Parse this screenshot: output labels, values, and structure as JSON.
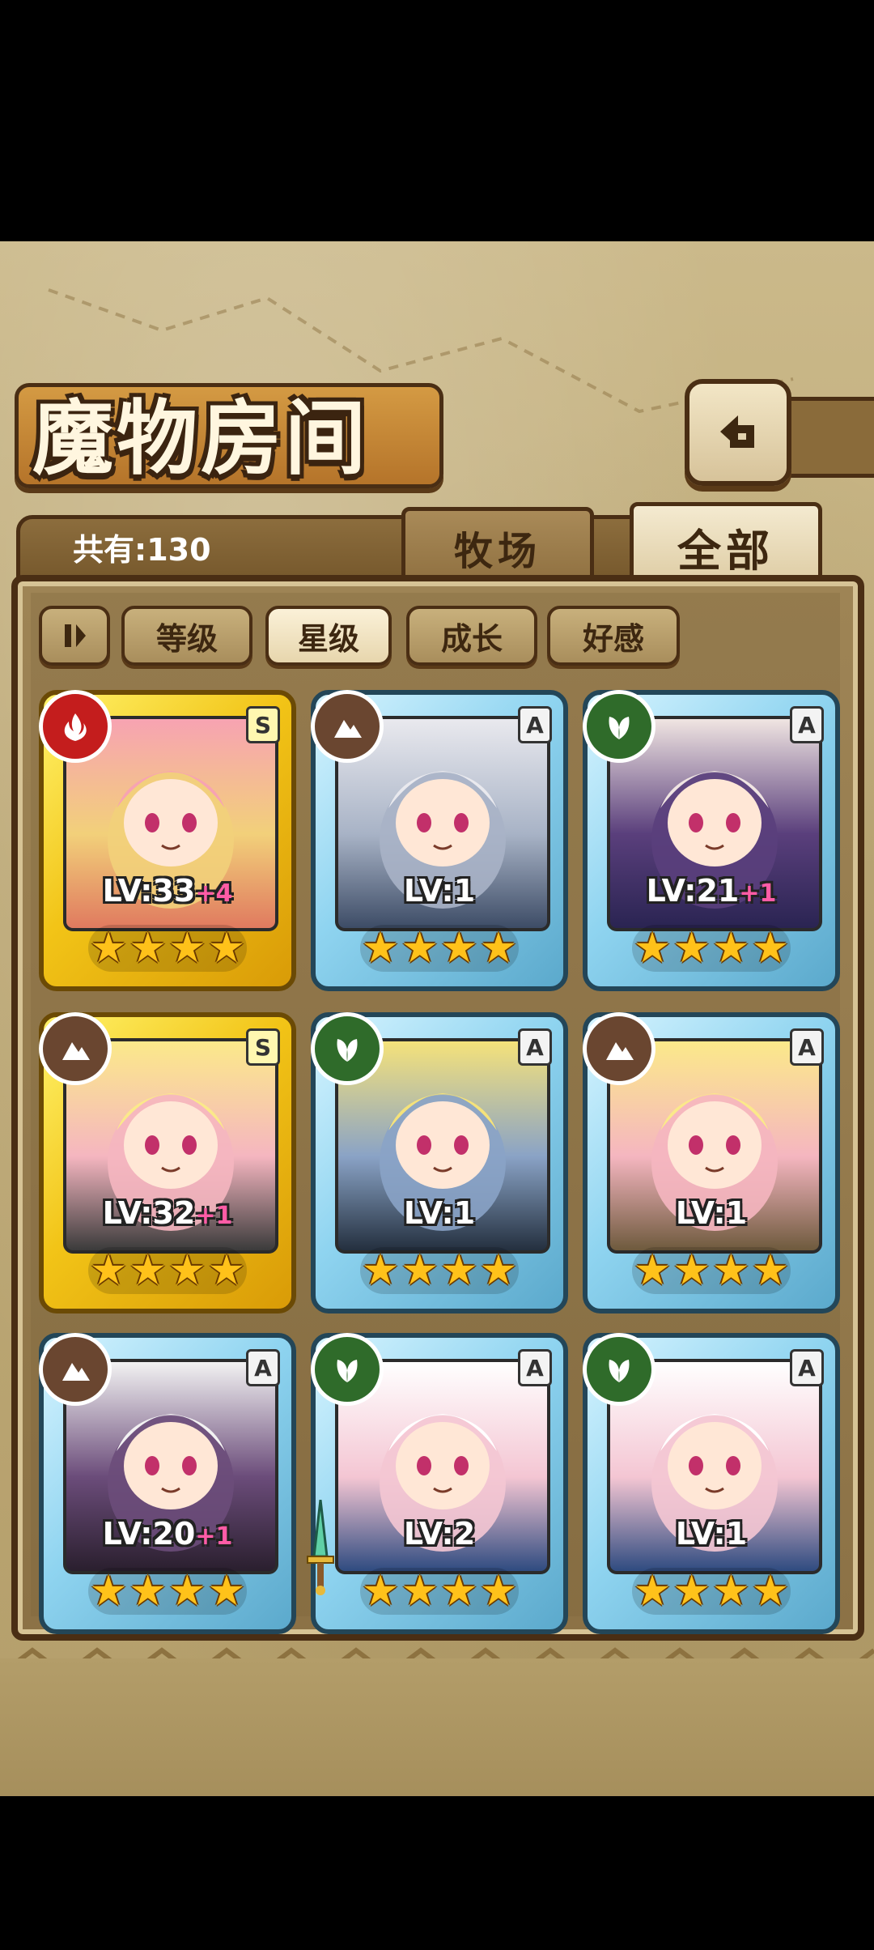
{
  "header": {
    "title": "魔物房间",
    "back_icon": "return-icon"
  },
  "info": {
    "total": "共有:130"
  },
  "tabs": [
    {
      "label": "牧场",
      "active": false
    },
    {
      "label": "全部",
      "active": true
    }
  ],
  "sort": {
    "toggle_icon": "pause-icon",
    "buttons": [
      {
        "label": "等级",
        "active": false
      },
      {
        "label": "星级",
        "active": true
      },
      {
        "label": "成长",
        "active": false
      },
      {
        "label": "好感",
        "active": false
      }
    ]
  },
  "monsters": [
    {
      "rank": "S",
      "element": "fire",
      "level": "LV:33",
      "bonus": "+4",
      "stars": 4,
      "palette": [
        "#f7a3b2",
        "#f2d07a",
        "#e07a5f"
      ]
    },
    {
      "rank": "A",
      "element": "earth",
      "level": "LV:1",
      "bonus": "",
      "stars": 4,
      "palette": [
        "#e9e9ee",
        "#a8b3c6",
        "#3d4c66"
      ]
    },
    {
      "rank": "A",
      "element": "wood",
      "level": "LV:21",
      "bonus": "+1",
      "stars": 4,
      "palette": [
        "#f0e5e2",
        "#5a3f7c",
        "#2a2452"
      ]
    },
    {
      "rank": "S",
      "element": "earth",
      "level": "LV:32",
      "bonus": "+1",
      "stars": 4,
      "palette": [
        "#fbe98a",
        "#f5b6c0",
        "#3b3b3b"
      ]
    },
    {
      "rank": "A",
      "element": "wood",
      "level": "LV:1",
      "bonus": "",
      "stars": 4,
      "palette": [
        "#f5e27a",
        "#8aa3c6",
        "#24303f"
      ]
    },
    {
      "rank": "A",
      "element": "earth",
      "level": "LV:1",
      "bonus": "",
      "stars": 4,
      "palette": [
        "#fbe98a",
        "#f5b6c0",
        "#6e5a3d"
      ]
    },
    {
      "rank": "A",
      "element": "earth",
      "level": "LV:20",
      "bonus": "+1",
      "stars": 4,
      "palette": [
        "#f2f2f2",
        "#6b4c7a",
        "#2a1f2e"
      ]
    },
    {
      "rank": "A",
      "element": "wood",
      "level": "LV:2",
      "bonus": "",
      "stars": 4,
      "palette": [
        "#ffffff",
        "#f4c6d3",
        "#2f4b80"
      ],
      "equip": "sword"
    },
    {
      "rank": "A",
      "element": "wood",
      "level": "LV:1",
      "bonus": "",
      "stars": 4,
      "palette": [
        "#ffffff",
        "#f4c6d3",
        "#2f4b80"
      ]
    }
  ]
}
